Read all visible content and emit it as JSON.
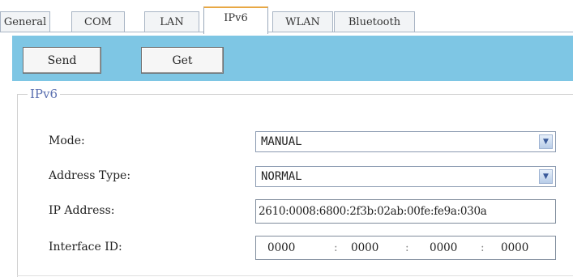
{
  "tabs": [
    {
      "label": "General"
    },
    {
      "label": "COM"
    },
    {
      "label": "LAN"
    },
    {
      "label": "IPv6",
      "active": true
    },
    {
      "label": "WLAN"
    },
    {
      "label": "Bluetooth"
    }
  ],
  "toolbar": {
    "send_label": "Send",
    "get_label": "Get"
  },
  "ipv6_group": {
    "title": "IPv6",
    "mode": {
      "label": "Mode:",
      "value": "MANUAL"
    },
    "address_type": {
      "label": "Address Type:",
      "value": "NORMAL"
    },
    "ip_address": {
      "label": "IP Address:",
      "value": "2610:0008:6800:2f3b:02ab:00fe:fe9a:030a"
    },
    "interface_id": {
      "label": "Interface ID:",
      "segments": [
        "0000",
        "0000",
        "0000",
        "0000"
      ],
      "separators": [
        ":",
        ":",
        ":"
      ]
    }
  },
  "colors": {
    "toolbar_bg": "#7ec6e4",
    "active_tab_accent": "#e8a844",
    "group_title": "#5a6fb0"
  }
}
